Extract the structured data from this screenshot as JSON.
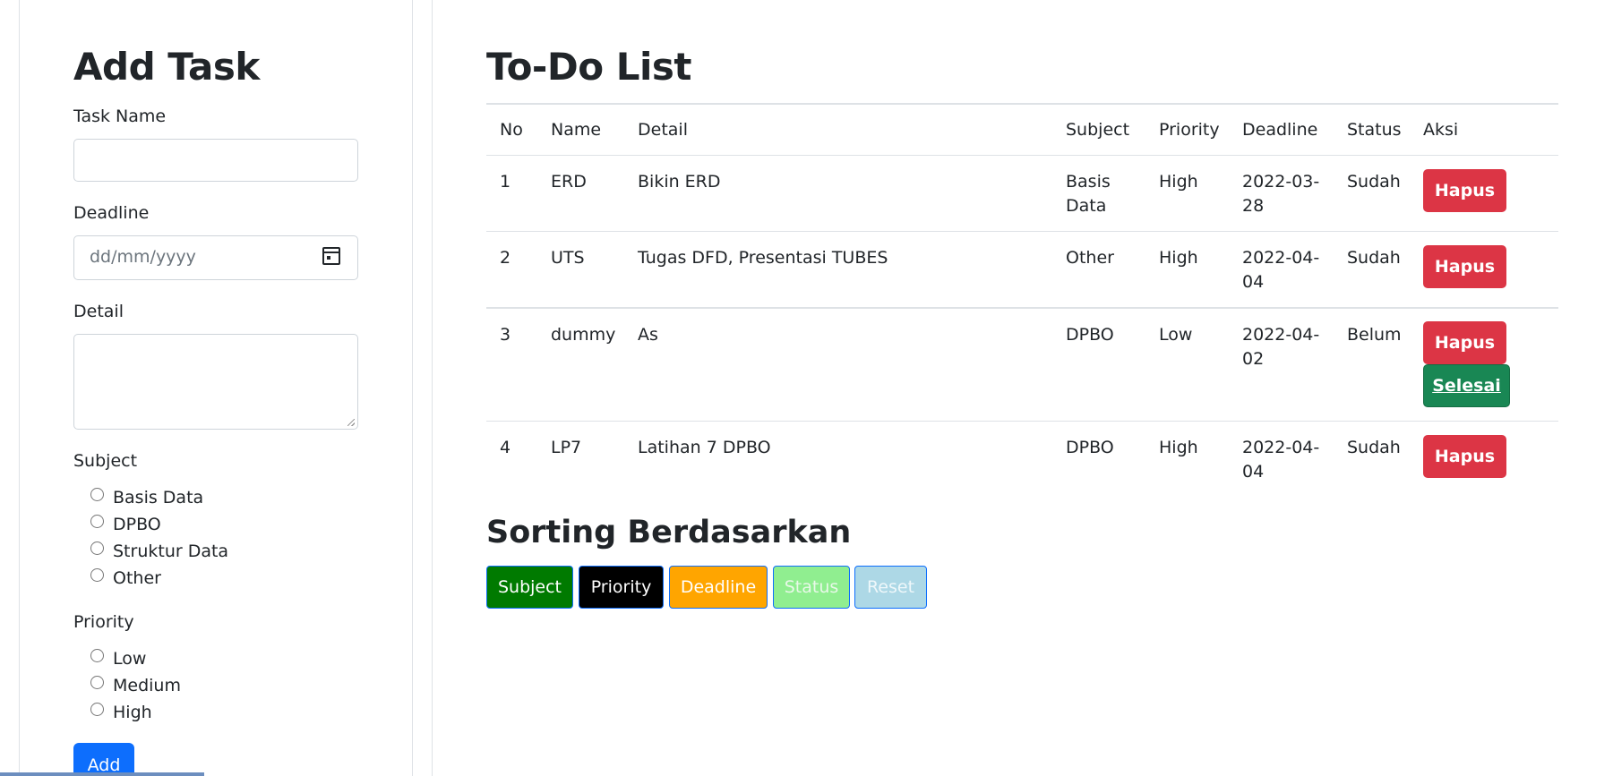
{
  "form": {
    "title": "Add Task",
    "task_name_label": "Task Name",
    "task_name_value": "",
    "deadline_label": "Deadline",
    "deadline_placeholder": "dd/mm/yyyy",
    "detail_label": "Detail",
    "detail_value": "",
    "subject_label": "Subject",
    "subjects": [
      "Basis Data",
      "DPBO",
      "Struktur Data",
      "Other"
    ],
    "priority_label": "Priority",
    "priorities": [
      "Low",
      "Medium",
      "High"
    ],
    "add_label": "Add"
  },
  "table": {
    "title": "To-Do List",
    "headers": [
      "No",
      "Name",
      "Detail",
      "Subject",
      "Priority",
      "Deadline",
      "Status",
      "Aksi"
    ],
    "rows": [
      {
        "no": "1",
        "name": "ERD",
        "detail": "Bikin ERD",
        "subject": "Basis Data",
        "priority": "High",
        "deadline": "2022-03-28",
        "status": "Sudah",
        "hapus": "Hapus"
      },
      {
        "no": "2",
        "name": "UTS",
        "detail": "Tugas DFD, Presentasi TUBES",
        "subject": "Other",
        "priority": "High",
        "deadline": "2022-04-04",
        "status": "Sudah",
        "hapus": "Hapus"
      },
      {
        "no": "3",
        "name": "dummy",
        "detail": "As",
        "subject": "DPBO",
        "priority": "Low",
        "deadline": "2022-04-02",
        "status": "Belum",
        "hapus": "Hapus",
        "selesai": "Selesai"
      },
      {
        "no": "4",
        "name": "LP7",
        "detail": "Latihan 7 DPBO",
        "subject": "DPBO",
        "priority": "High",
        "deadline": "2022-04-04",
        "status": "Sudah",
        "hapus": "Hapus"
      }
    ]
  },
  "sorting": {
    "title": "Sorting Berdasarkan",
    "buttons": [
      {
        "label": "Subject",
        "bg": "#007a00",
        "fg": "#ffffff"
      },
      {
        "label": "Priority",
        "bg": "#000000",
        "fg": "#ffffff"
      },
      {
        "label": "Deadline",
        "bg": "#ffa500",
        "fg": "#ffffff"
      },
      {
        "label": "Status",
        "bg": "#90ee90",
        "fg": "#e8f8e8"
      },
      {
        "label": "Reset",
        "bg": "#add8e6",
        "fg": "#eef7fa"
      }
    ]
  },
  "colors": {
    "primary": "#0d6efd",
    "danger": "#dc3545",
    "success": "#198754"
  }
}
